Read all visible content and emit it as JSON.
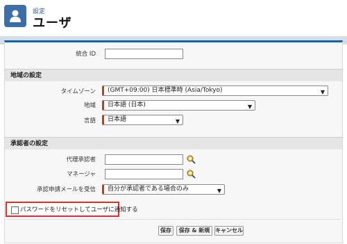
{
  "header": {
    "breadcrumb": "設定",
    "title": "ユーザ"
  },
  "fields": {
    "federation_id_label": "統合 ID",
    "federation_id_value": ""
  },
  "locale_section": {
    "heading": "地域の設定",
    "timezone_label": "タイムゾーン",
    "timezone_value": "(GMT+09:00) 日本標準時 (Asia/Tokyo)",
    "locale_label": "地域",
    "locale_value": "日本語 (日本)",
    "language_label": "言語",
    "language_value": "日本語"
  },
  "approver_section": {
    "heading": "承認者の設定",
    "delegated_label": "代理承認者",
    "manager_label": "マネージャ",
    "email_label": "承認申請メールを受信",
    "email_value": "自分が承認者である場合のみ"
  },
  "reset_password": {
    "label": "パスワードをリセットしてユーザに通知する",
    "checked": false
  },
  "buttons": {
    "save": "保存",
    "save_new": "保存 & 新規",
    "cancel": "キャンセル"
  },
  "colors": {
    "accent": "#1f5f96",
    "required": "#c23934",
    "highlight": "#d8322b"
  }
}
